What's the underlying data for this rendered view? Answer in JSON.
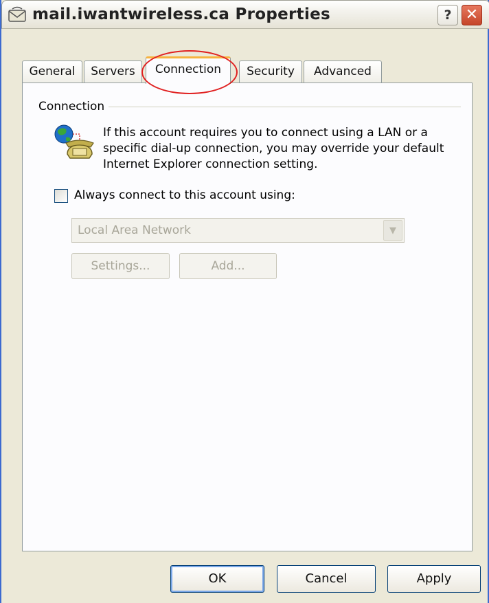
{
  "window": {
    "title": "mail.iwantwireless.ca Properties",
    "help_label": "?",
    "close_label": "✕"
  },
  "tabs": [
    {
      "label": "General"
    },
    {
      "label": "Servers"
    },
    {
      "label": "Connection",
      "active": true
    },
    {
      "label": "Security"
    },
    {
      "label": "Advanced"
    }
  ],
  "connection": {
    "group_label": "Connection",
    "description_lines": [
      "If this account requires you to connect using a LAN or a",
      "specific dial-up connection, you may override your default",
      "Internet Explorer connection setting."
    ],
    "always_connect_label": "Always connect to this account using:",
    "always_connect_checked": false,
    "network_selected": "Local Area Network",
    "settings_label": "Settings...",
    "add_label": "Add..."
  },
  "footer": {
    "ok_label": "OK",
    "cancel_label": "Cancel",
    "apply_label": "Apply"
  },
  "colors": {
    "accent_tab": "#f7b33f",
    "annotation": "#e02020"
  }
}
